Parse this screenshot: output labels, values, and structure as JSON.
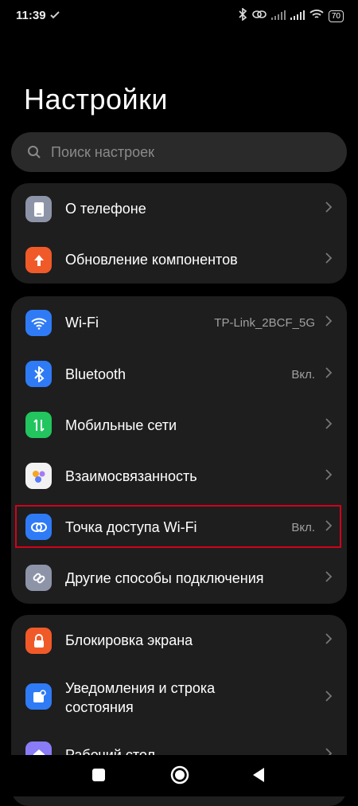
{
  "status": {
    "time": "11:39",
    "battery": "70"
  },
  "title": "Настройки",
  "search": {
    "placeholder": "Поиск настроек"
  },
  "group1": [
    {
      "label": "О телефоне",
      "value": ""
    },
    {
      "label": "Обновление компонентов",
      "value": ""
    }
  ],
  "group2": [
    {
      "label": "Wi-Fi",
      "value": "TP-Link_2BCF_5G"
    },
    {
      "label": "Bluetooth",
      "value": "Вкл."
    },
    {
      "label": "Мобильные сети",
      "value": ""
    },
    {
      "label": "Взаимосвязанность",
      "value": ""
    },
    {
      "label": "Точка доступа Wi-Fi",
      "value": "Вкл."
    },
    {
      "label": "Другие способы подключения",
      "value": ""
    }
  ],
  "group3": [
    {
      "label": "Блокировка экрана",
      "value": ""
    },
    {
      "label": "Уведомления и строка состояния",
      "value": ""
    },
    {
      "label": "Рабочий стол",
      "value": ""
    }
  ],
  "colors": {
    "blue": "#2f7bf6",
    "orange": "#f05a28",
    "green": "#22c55e",
    "gray": "#8e94a8",
    "highlight": "#d0021b"
  },
  "icons": [
    "phone-icon",
    "update-arrow-icon",
    "wifi-icon",
    "bluetooth-icon",
    "mobile-data-icon",
    "interconnect-icon",
    "hotspot-icon",
    "link-icon",
    "lock-icon",
    "notification-icon",
    "home-icon"
  ]
}
